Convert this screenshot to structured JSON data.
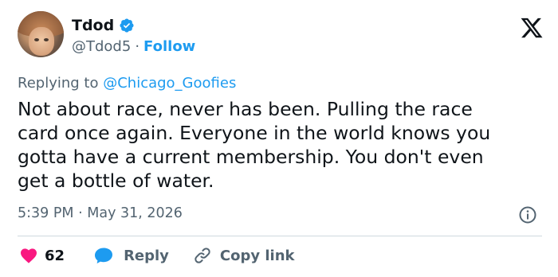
{
  "user": {
    "display_name": "Tdod",
    "handle": "@Tdod5",
    "separator": "·",
    "follow_label": "Follow"
  },
  "reply_context": {
    "prefix": "Replying to",
    "mention": "@Chicago_Goofies"
  },
  "tweet": {
    "text": "Not about race, never has been. Pulling the race\ncard once again. Everyone in the world knows you\ngotta have a current membership. You don't even\nget a bottle of water.",
    "time": "5:39 PM",
    "separator": "·",
    "date": "May 31, 2026"
  },
  "actions": {
    "likes_count": "62",
    "reply_label": "Reply",
    "copy_link_label": "Copy link"
  },
  "colors": {
    "accent": "#1d9bf0",
    "heart": "#f91880",
    "muted": "#536471",
    "text": "#0f1419",
    "divider": "#cfd9de"
  },
  "icons": [
    "avatar",
    "verified-badge-icon",
    "x-logo-icon",
    "info-icon",
    "heart-icon",
    "reply-bubble-icon",
    "link-icon"
  ]
}
